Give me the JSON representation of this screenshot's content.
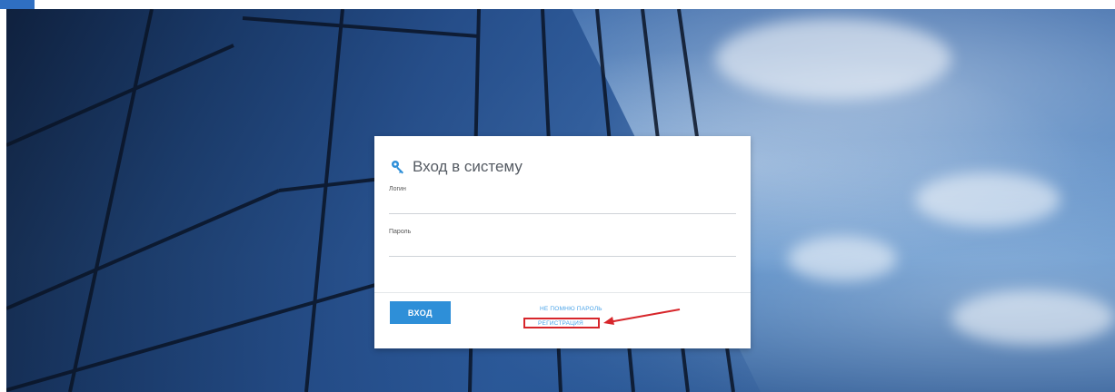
{
  "login_card": {
    "title": "Вход в систему",
    "login_label": "Логин",
    "login_value": "",
    "password_label": "Пароль",
    "password_value": "",
    "submit_label": "ВХОД",
    "forgot_link": "НЕ ПОМНЮ ПАРОЛЬ",
    "register_link": "РЕГИСТРАЦИЯ"
  },
  "icons": {
    "title_icon": "key-icon"
  },
  "colors": {
    "accent": "#2e8fd8",
    "link": "#4aa3e8",
    "annotation": "#d7262b"
  }
}
